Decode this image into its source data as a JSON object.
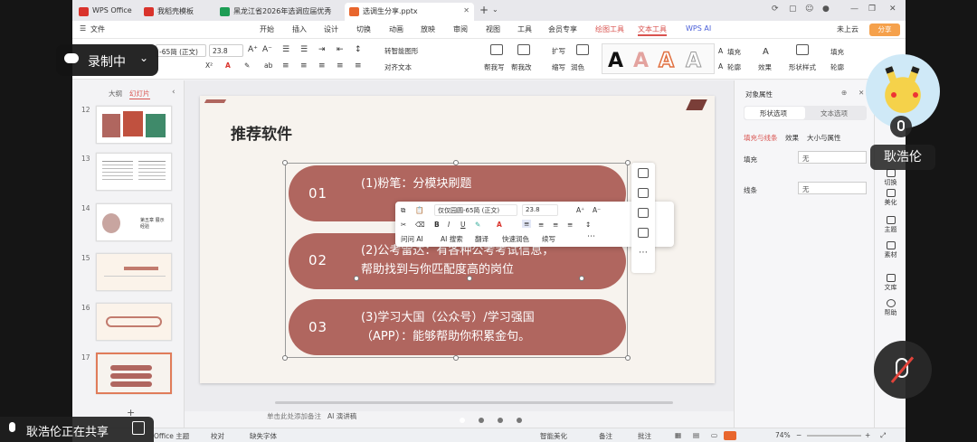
{
  "tabs": [
    {
      "label": "WPS Office",
      "color": "#d9332c"
    },
    {
      "label": "我稻壳模板",
      "color": "#d9332c"
    },
    {
      "label": "黑龙江省2026年选调应届优秀",
      "color": "#1d9d55"
    },
    {
      "label": "选调生分享.pptx",
      "color": "#e8662d"
    }
  ],
  "new_tab": "+",
  "menubar": {
    "file": "文件",
    "items": [
      "开始",
      "插入",
      "设计",
      "切换",
      "动画",
      "放映",
      "审阅",
      "视图",
      "工具",
      "会员专享",
      "绘图工具",
      "文本工具",
      "WPS AI"
    ],
    "cloud": "未上云",
    "share": "分享"
  },
  "ribbon": {
    "font_name": "-65简 (正文)",
    "font_size": "23.8",
    "smart_graphic": "转智能图形",
    "align_text": "对齐文本",
    "buttons": [
      "帮我写",
      "帮我改",
      "扩写",
      "缩写",
      "润色"
    ],
    "fill": "填充",
    "outline": "轮廓",
    "effect": "效果",
    "shape_style": "形状样式",
    "text_fill": "填充",
    "text_outline": "轮廓"
  },
  "left_panel": {
    "tab_outline": "大纲",
    "tab_slides": "幻灯片",
    "slide_numbers": [
      "12",
      "13",
      "14",
      "15",
      "16",
      "17"
    ],
    "slide14_text": "第五章 展示经验"
  },
  "slide": {
    "title": "推荐软件",
    "items": [
      {
        "num": "01",
        "line1": "(1)粉笔：分模块刷题",
        "line2": ""
      },
      {
        "num": "02",
        "line1": "(2)公考雷达：有各种公考考试信息，",
        "line2": "帮助找到与你匹配度高的岗位"
      },
      {
        "num": "03",
        "line1": "(3)学习大国（公众号）/学习强国",
        "line2": "（APP）：能够帮助你积累金句。"
      }
    ],
    "pill_color": "#b0665f"
  },
  "float_toolbar": {
    "font_name": "仅仅园圆-65简 (正文)",
    "font_size": "23.8",
    "ask_ai": "问问 AI",
    "ai_search": "AI 搜索",
    "translate": "翻译",
    "quick_polish": "快速润色",
    "continue_write": "续写"
  },
  "right_panel": {
    "title": "对象属性",
    "tab_shape": "形状选项",
    "tab_text": "文本选项",
    "subtab_fill": "填充与线条",
    "subtab_effect": "效果",
    "subtab_size": "大小与属性",
    "fill_label": "填充",
    "fill_value": "无",
    "line_label": "线条",
    "line_value": "无"
  },
  "far_right": [
    "切换",
    "美化",
    "主题",
    "素材",
    "文库",
    "帮助"
  ],
  "notes_placeholder": "单击此处添加备注",
  "ai_notes": "AI 演讲稿",
  "statusbar": {
    "theme": "Office 主题",
    "proofread": "校对",
    "missing_font": "缺失字体",
    "smart_beautify": "智能美化",
    "notes": "备注",
    "comments": "批注",
    "zoom": "74%"
  },
  "overlay": {
    "recording": "录制中",
    "sharing": "耿浩伦正在共享",
    "user_name": "耿浩伦"
  }
}
